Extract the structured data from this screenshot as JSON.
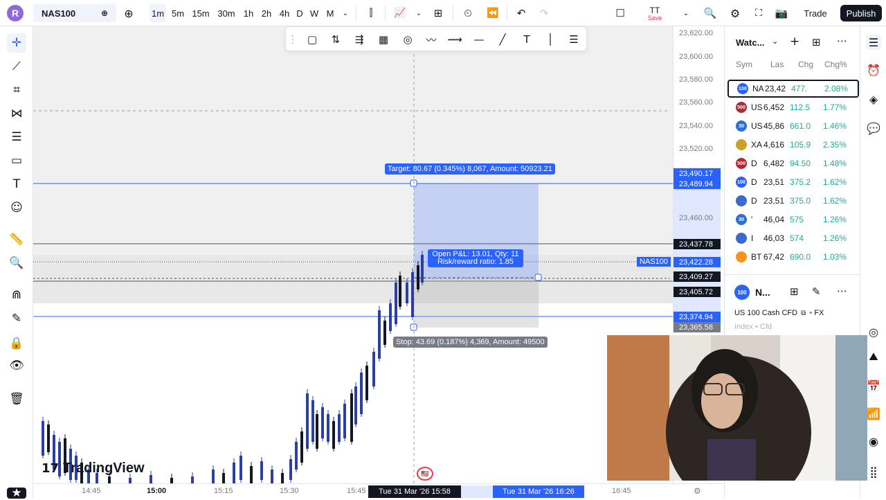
{
  "topbar": {
    "avatar_letter": "R",
    "symbol": "NAS100",
    "timeframes": [
      "1m",
      "5m",
      "15m",
      "30m",
      "1h",
      "2h",
      "4h",
      "D",
      "W",
      "M"
    ],
    "active_timeframe": "1m",
    "profile_label": "TT",
    "save_label": "Save",
    "trade_label": "Trade",
    "publish_label": "Publish"
  },
  "chart": {
    "layout_count": "2",
    "target_label": "Target: 80.67 (0.345%) 8,067, Amount: 50923.21",
    "stop_label": "Stop: 43.69 (0.187%) 4,369, Amount: 49500",
    "pnl_label": "Open P&L: 13.01, Qty: 11",
    "rr_label": "Risk/reward ratio: 1.85",
    "symbol_tag": "NAS100",
    "watermark": "TradingView"
  },
  "price_axis": {
    "ticks": [
      "23,620.00",
      "23,600.00",
      "23,580.00",
      "23,560.00",
      "23,540.00",
      "23,520.00",
      "23,460.00"
    ],
    "labels": [
      {
        "value": "23,490.17",
        "color": "#2962ff"
      },
      {
        "value": "23,489.94",
        "color": "#2962ff"
      },
      {
        "value": "23,437.78",
        "color": "#131722"
      },
      {
        "value": "23,422.28",
        "color": "#2962ff"
      },
      {
        "value": "23,409.27",
        "color": "#131722"
      },
      {
        "value": "23,405.72",
        "color": "#131722"
      },
      {
        "value": "23,374.94",
        "color": "#2962ff"
      },
      {
        "value": "23,365.58",
        "color": "#787b86"
      }
    ]
  },
  "time_axis": {
    "ticks": [
      "14:45",
      "15:00",
      "15:15",
      "15:30",
      "15:45",
      "16:45"
    ],
    "crosshair_label": "Tue 31 Mar '26   15:58",
    "range_end_label": "Tue 31 Mar '26   16:26"
  },
  "watchlist": {
    "title": "Watc...",
    "columns": [
      "Sym",
      "Las",
      "Chg",
      "Chg%"
    ],
    "rows": [
      {
        "badge": "100",
        "badge_color": "#2962ff",
        "sym": "NA",
        "last": "23,42",
        "chg": "477.",
        "pct": "2.08%"
      },
      {
        "badge": "500",
        "badge_color": "#b22833",
        "sym": "US",
        "last": "6,452",
        "chg": "112.5",
        "pct": "1.77%"
      },
      {
        "badge": "30",
        "badge_color": "#2a6fdb",
        "sym": "US",
        "last": "45,86",
        "chg": "661.0",
        "pct": "1.46%"
      },
      {
        "badge": "",
        "badge_color": "#c9a227",
        "sym": "XA",
        "last": "4,616",
        "chg": "105.9",
        "pct": "2.35%"
      },
      {
        "badge": "500",
        "badge_color": "#b22833",
        "sym": "D",
        "last": "6,482",
        "chg": "94.50",
        "pct": "1.48%"
      },
      {
        "badge": "100",
        "badge_color": "#2962ff",
        "sym": "D",
        "last": "23,51",
        "chg": "375.2",
        "pct": "1.62%"
      },
      {
        "badge": "",
        "badge_color": "#3c6acb",
        "sym": "D",
        "last": "23,51",
        "chg": "375.0",
        "pct": "1.62%"
      },
      {
        "badge": "30",
        "badge_color": "#2a6fdb",
        "sym": "'",
        "last": "46,04",
        "chg": "575",
        "pct": "1.26%"
      },
      {
        "badge": "",
        "badge_color": "#3c6acb",
        "sym": "I",
        "last": "46,03",
        "chg": "574",
        "pct": "1.26%"
      },
      {
        "badge": "",
        "badge_color": "#f7931a",
        "sym": "BT",
        "last": "67,42",
        "chg": "690.0",
        "pct": "1.03%"
      }
    ]
  },
  "details": {
    "badge": "100",
    "short_name": "N...",
    "full_name": "US 100 Cash CFD",
    "exchange": "FX",
    "category": "Index • Cfd"
  }
}
